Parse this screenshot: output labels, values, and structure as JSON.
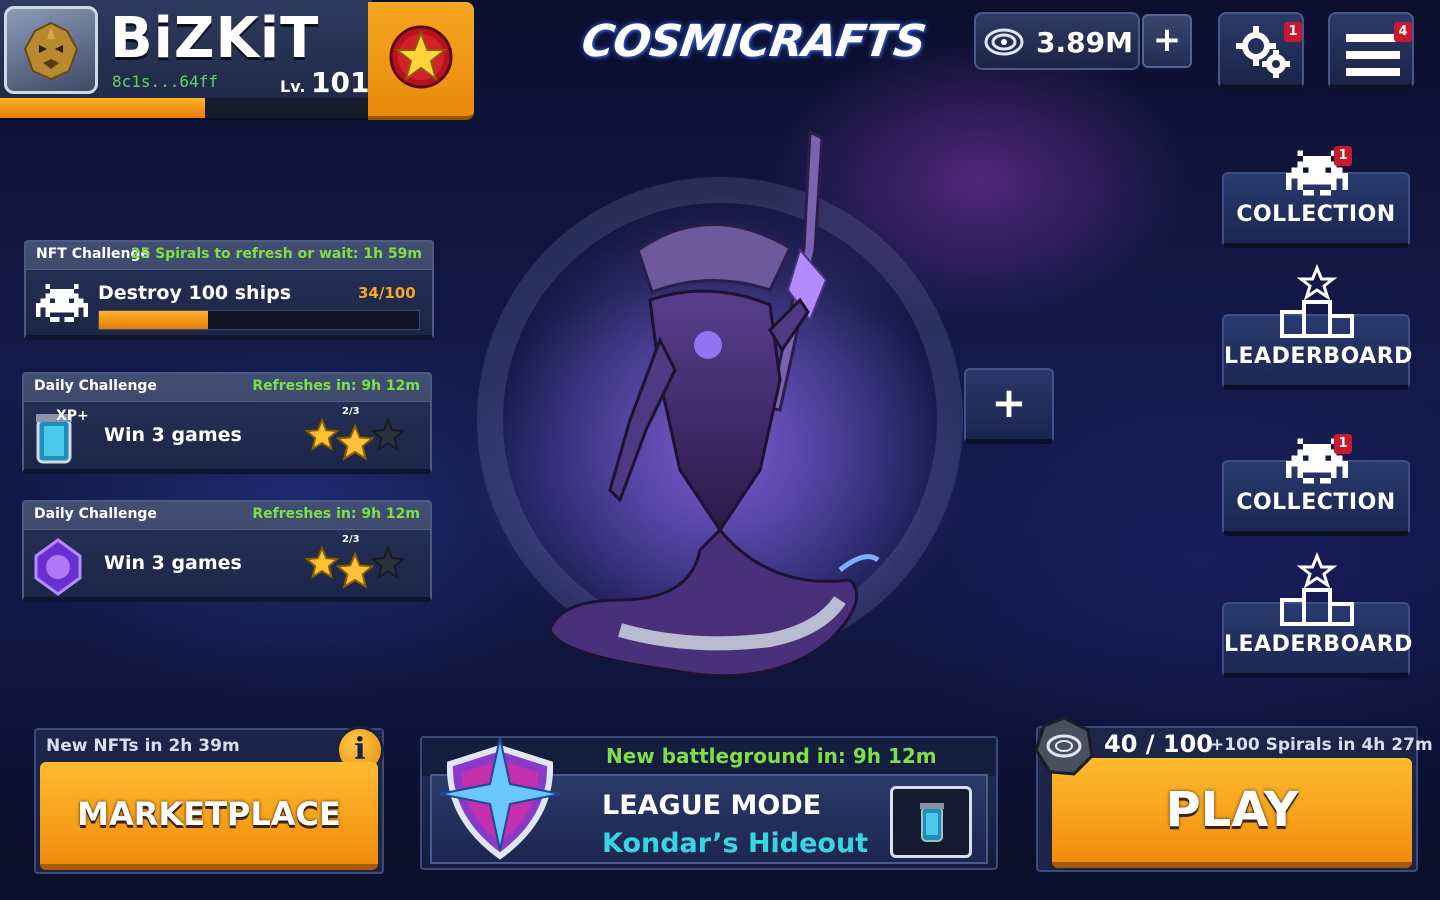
{
  "player": {
    "name": "BiZKiT",
    "wallet": "8c1s...64ff",
    "level_prefix": "Lv.",
    "level": "101",
    "xp_fraction": 0.55
  },
  "logo": {
    "text": "COSMICRAFTS"
  },
  "currency": {
    "value": "3.89M",
    "add_label": "+"
  },
  "notifications": {
    "settings": "1",
    "menu": "4",
    "collection": "1"
  },
  "nft_challenge": {
    "label": "NFT Challenge",
    "refresh_text": "25 Spirals to refresh or wait: 1h 59m",
    "title": "Destroy 100 ships",
    "progress_text": "34/100",
    "progress": 0.34
  },
  "daily_challenges": [
    {
      "label": "Daily Challenge",
      "refresh_text": "Refreshes in: 9h 12m",
      "title": "Win 3 games",
      "count": "2/3",
      "stars_filled": 2,
      "stars_total": 3,
      "badge": "XP+"
    },
    {
      "label": "Daily Challenge",
      "refresh_text": "Refreshes in: 9h 12m",
      "title": "Win 3 games",
      "count": "2/3",
      "stars_filled": 2,
      "stars_total": 3
    }
  ],
  "side_nav": [
    {
      "label": "COLLECTION",
      "icon": "invader-icon"
    },
    {
      "label": "LEADERBOARD",
      "icon": "podium-icon"
    },
    {
      "label": "COLLECTION",
      "icon": "invader-icon"
    },
    {
      "label": "LEADERBOARD",
      "icon": "podium-icon"
    }
  ],
  "deck_add_label": "+",
  "marketplace": {
    "countdown": "New NFTs in 2h 39m",
    "info": "i",
    "button": "MARKETPLACE"
  },
  "league": {
    "timer": "New battleground in: 9h 12m",
    "mode": "LEAGUE MODE",
    "map": "Kondar’s Hideout"
  },
  "play": {
    "energy": "40 / 100",
    "refill": "+100 Spirals in 4h 27m",
    "button": "PLAY"
  },
  "colors": {
    "accent_orange": "#f6a623",
    "challenge_green": "#7fe046",
    "map_cyan": "#38d6e0",
    "notif_red": "#c8192e"
  }
}
